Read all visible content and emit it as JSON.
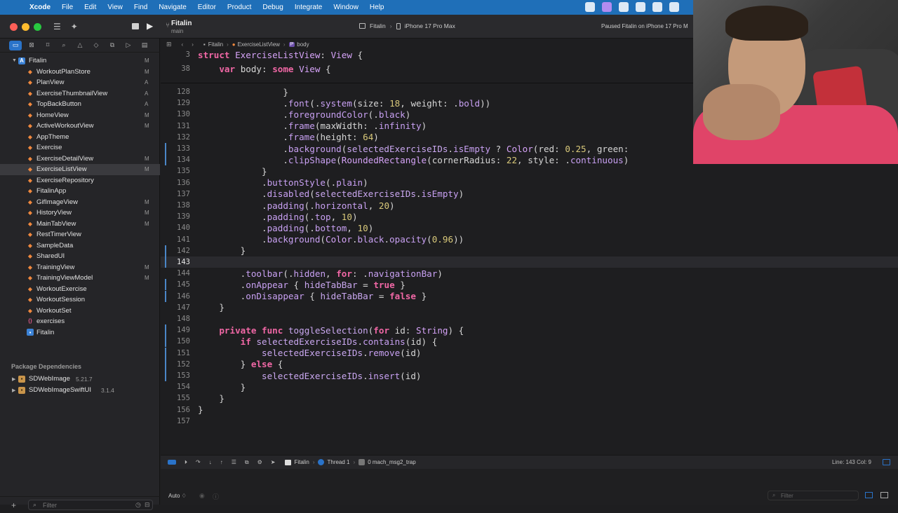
{
  "menubar": {
    "app_name": "Xcode",
    "menus": [
      "File",
      "Edit",
      "View",
      "Find",
      "Navigate",
      "Editor",
      "Product",
      "Debug",
      "Integrate",
      "Window",
      "Help"
    ]
  },
  "toolbar": {
    "project_name": "Fitalin",
    "branch": "main",
    "scheme": "Fitalin",
    "destination": "iPhone 17 Pro Max",
    "status": "Paused Fitalin on iPhone 17 Pro M"
  },
  "navigator": {
    "root": "Fitalin",
    "files": [
      {
        "name": "WorkoutPlanStore",
        "badge": "M"
      },
      {
        "name": "PlanView",
        "badge": "A"
      },
      {
        "name": "ExerciseThumbnailView",
        "badge": "A"
      },
      {
        "name": "TopBackButton",
        "badge": "A"
      },
      {
        "name": "HomeView",
        "badge": "M"
      },
      {
        "name": "ActiveWorkoutView",
        "badge": "M"
      },
      {
        "name": "AppTheme",
        "badge": ""
      },
      {
        "name": "Exercise",
        "badge": ""
      },
      {
        "name": "ExerciseDetailView",
        "badge": "M"
      },
      {
        "name": "ExerciseListView",
        "badge": "M"
      },
      {
        "name": "ExerciseRepository",
        "badge": ""
      },
      {
        "name": "FitalinApp",
        "badge": ""
      },
      {
        "name": "GifImageView",
        "badge": "M"
      },
      {
        "name": "HistoryView",
        "badge": "M"
      },
      {
        "name": "MainTabView",
        "badge": "M"
      },
      {
        "name": "RestTimerView",
        "badge": ""
      },
      {
        "name": "SampleData",
        "badge": ""
      },
      {
        "name": "SharedUI",
        "badge": ""
      },
      {
        "name": "TrainingView",
        "badge": "M"
      },
      {
        "name": "TrainingViewModel",
        "badge": "M"
      },
      {
        "name": "WorkoutExercise",
        "badge": ""
      },
      {
        "name": "WorkoutSession",
        "badge": ""
      },
      {
        "name": "WorkoutSet",
        "badge": ""
      },
      {
        "name": "exercises",
        "badge": ""
      },
      {
        "name": "Fitalin",
        "badge": ""
      }
    ],
    "package_header": "Package Dependencies",
    "packages": [
      {
        "name": "SDWebImage",
        "version": "5.21.7"
      },
      {
        "name": "SDWebImageSwiftUI",
        "version": "3.1.4"
      }
    ],
    "filter_placeholder": "Filter"
  },
  "jumpbar": {
    "crumbs": [
      "Fitalin",
      "ExerciseListView",
      "body"
    ]
  },
  "editor": {
    "sticky": [
      {
        "line": "3",
        "text": "struct ExerciseListView: View {"
      },
      {
        "line": "38",
        "text": "    var body: some View {"
      }
    ],
    "lines": [
      {
        "n": "128",
        "code": "                }"
      },
      {
        "n": "129",
        "code": "                .font(.system(size: 18, weight: .bold))"
      },
      {
        "n": "130",
        "code": "                .foregroundColor(.black)"
      },
      {
        "n": "131",
        "code": "                .frame(maxWidth: .infinity)"
      },
      {
        "n": "132",
        "code": "                .frame(height: 64)"
      },
      {
        "n": "133",
        "code": "                .background(selectedExerciseIDs.isEmpty ? Color(red: 0.25, green:"
      },
      {
        "n": "134",
        "code": "                .clipShape(RoundedRectangle(cornerRadius: 22, style: .continuous)"
      },
      {
        "n": "135",
        "code": "            }"
      },
      {
        "n": "136",
        "code": "            .buttonStyle(.plain)"
      },
      {
        "n": "137",
        "code": "            .disabled(selectedExerciseIDs.isEmpty)"
      },
      {
        "n": "138",
        "code": "            .padding(.horizontal, 20)"
      },
      {
        "n": "139",
        "code": "            .padding(.top, 10)"
      },
      {
        "n": "140",
        "code": "            .padding(.bottom, 10)"
      },
      {
        "n": "141",
        "code": "            .background(Color.black.opacity(0.96))"
      },
      {
        "n": "142",
        "code": "        }"
      },
      {
        "n": "143",
        "code": ""
      },
      {
        "n": "144",
        "code": "        .toolbar(.hidden, for: .navigationBar)"
      },
      {
        "n": "145",
        "code": "        .onAppear { hideTabBar = true }"
      },
      {
        "n": "146",
        "code": "        .onDisappear { hideTabBar = false }"
      },
      {
        "n": "147",
        "code": "    }"
      },
      {
        "n": "148",
        "code": ""
      },
      {
        "n": "149",
        "code": "    private func toggleSelection(for id: String) {"
      },
      {
        "n": "150",
        "code": "        if selectedExerciseIDs.contains(id) {"
      },
      {
        "n": "151",
        "code": "            selectedExerciseIDs.remove(id)"
      },
      {
        "n": "152",
        "code": "        } else {"
      },
      {
        "n": "153",
        "code": "            selectedExerciseIDs.insert(id)"
      },
      {
        "n": "154",
        "code": "        }"
      },
      {
        "n": "155",
        "code": "    }"
      },
      {
        "n": "156",
        "code": "}"
      },
      {
        "n": "157",
        "code": ""
      }
    ]
  },
  "debugbar": {
    "target": "Fitalin",
    "thread": "Thread 1",
    "frame": "0 mach_msg2_trap",
    "cursor": "Line: 143  Col: 9"
  },
  "console": {
    "mode": "Auto ♢",
    "filter_placeholder": "Filter"
  },
  "colors": {
    "menubar": "#1f6fb8",
    "selection_accent": "#2a73c9",
    "keyword": "#f067a5",
    "type": "#d5a3f7",
    "number": "#d9c97a"
  }
}
